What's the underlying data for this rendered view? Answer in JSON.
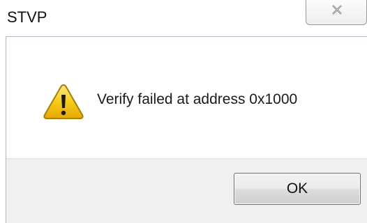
{
  "window": {
    "title": "STVP",
    "close_icon": "close-x-icon"
  },
  "dialog": {
    "icon": "warning-icon",
    "message": "Verify failed at address 0x1000",
    "ok_label": "OK",
    "colors": {
      "warning_fill": "#f2c100",
      "warning_border": "#b58a00",
      "footer_bg": "#f0f0f0"
    }
  }
}
